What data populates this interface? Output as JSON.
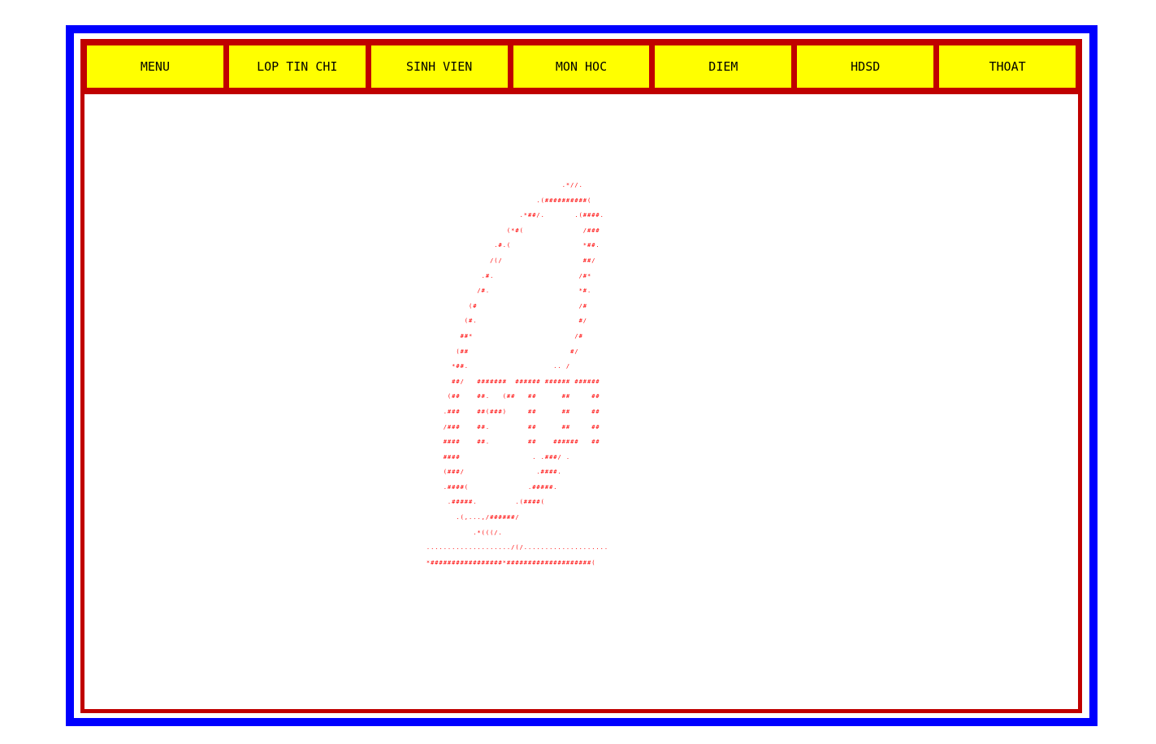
{
  "menu": {
    "items": [
      {
        "label": "MENU",
        "name": "menu-item-menu"
      },
      {
        "label": "LOP TIN CHI",
        "name": "menu-item-lop-tin-chi"
      },
      {
        "label": "SINH VIEN",
        "name": "menu-item-sinh-vien"
      },
      {
        "label": "MON HOC",
        "name": "menu-item-mon-hoc"
      },
      {
        "label": "DIEM",
        "name": "menu-item-diem"
      },
      {
        "label": "HDSD",
        "name": "menu-item-hdsd"
      },
      {
        "label": "THOAT",
        "name": "menu-item-thoat"
      }
    ]
  },
  "colors": {
    "outer_border": "#0000ff",
    "inner_border": "#c00000",
    "menu_background": "#ffff00",
    "ascii_art": "#ff0000"
  },
  "logo": {
    "ascii_art": "                                    .*//.\n                              .(##########(\n                          .*##/.       .(####.\n                       (*#(              /###\n                    .#.(                 *##.\n                   /(/                   ##/\n                 .#.                    /#*\n                /#.                     *#.\n              (#                        /#\n             (#.                        #/\n            ##*                        /#\n           (##                        #/\n          *##.                    .. /\n          ##/   #######  ###### ###### ######\n         (##    ##.   (##   ##      ##     ##\n        .###    ##(###)     ##      ##     ##\n        /###    ##.         ##      ##     ##\n        ####    ##.         ##    ######   ##\n        ####                 . .###/ .\n        (###/                 .####.\n        .####(              .#####.\n         .#####.         .(####(\n           .(,...,/######/\n               .*(((/.\n    ..................../(/....................\n    *#################*####################("
  }
}
